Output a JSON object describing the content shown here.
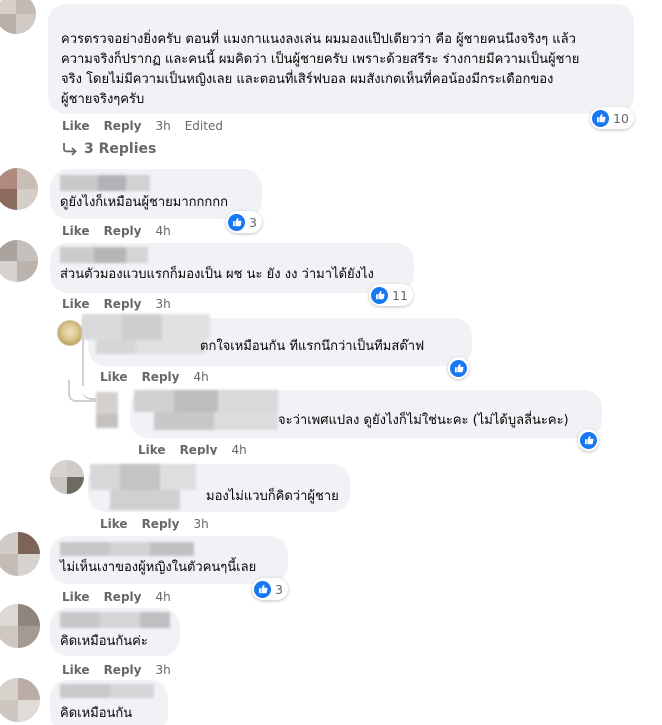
{
  "actions": {
    "like": "Like",
    "reply": "Reply",
    "edited": "Edited"
  },
  "colors": {
    "reaction_blue": "#1877f2",
    "bubble_gray": "#f0f2f5",
    "meta_gray": "#65676b"
  },
  "comments": [
    {
      "lines": [
        "ควรตรวจอย่างยิ่งครับ ตอนที่ แมงกาแนงลงเล่น ผมมองแป๊ปเดียวว่า คือ ผู้ชายคนนึงจริงๆ แล้ว",
        "ความจริงก็ปรากฏ และคนนี้ ผมคิดว่า เป็นผู้ชายครับ เพราะด้วยสรีระ ร่างกายมีความเป็นผู้ชาย",
        "จริง โดยไม่มีความเป็นหญิงเลย และตอนที่เสิร์ฟบอล ผมสังเกตเห็นที่คอน้องมีกระเดือกของ",
        "ผู้ชายจริงๆครับ"
      ],
      "time": "3h",
      "edited": true,
      "reactions": "10",
      "reaction_icon": "like-icon"
    },
    {
      "replies_label": "3 Replies",
      "icon": "reply-arrow-icon"
    },
    {
      "text": "ดูยังไงก็เหมือนผู้ชายมากกกกก",
      "time": "4h",
      "reactions": "3"
    },
    {
      "text": "ส่วนตัวมองแวบแรกก็มองเป็น ผช นะ ยัง งง ว่ามาได้ยังไง",
      "time": "3h",
      "reactions": "11"
    },
    {
      "text": "ตกใจเหมือนกัน ทีแรกนึกว่าเป็นทีมสต๊าฟ",
      "time": "4h",
      "reactions": ""
    },
    {
      "text": "จะว่าเพศแปลง ดูยังไงก็ไม่ใช่นะคะ (ไม่ได้บูลลี่นะคะ)",
      "time": "4h",
      "reactions": ""
    },
    {
      "text": "มองไม่แวบก็คิดว่าผู้ชาย",
      "time": "3h",
      "reactions": ""
    },
    {
      "text": "ไม่เห็นเงาของผู้หญิงในตัวคนๆนี้เลย",
      "time": "4h",
      "reactions": "3"
    },
    {
      "text": "คิดเหมือนกันค่ะ",
      "time": "3h",
      "reactions": ""
    },
    {
      "text": "คิดเหมือนกัน",
      "time": "",
      "reactions": ""
    }
  ]
}
